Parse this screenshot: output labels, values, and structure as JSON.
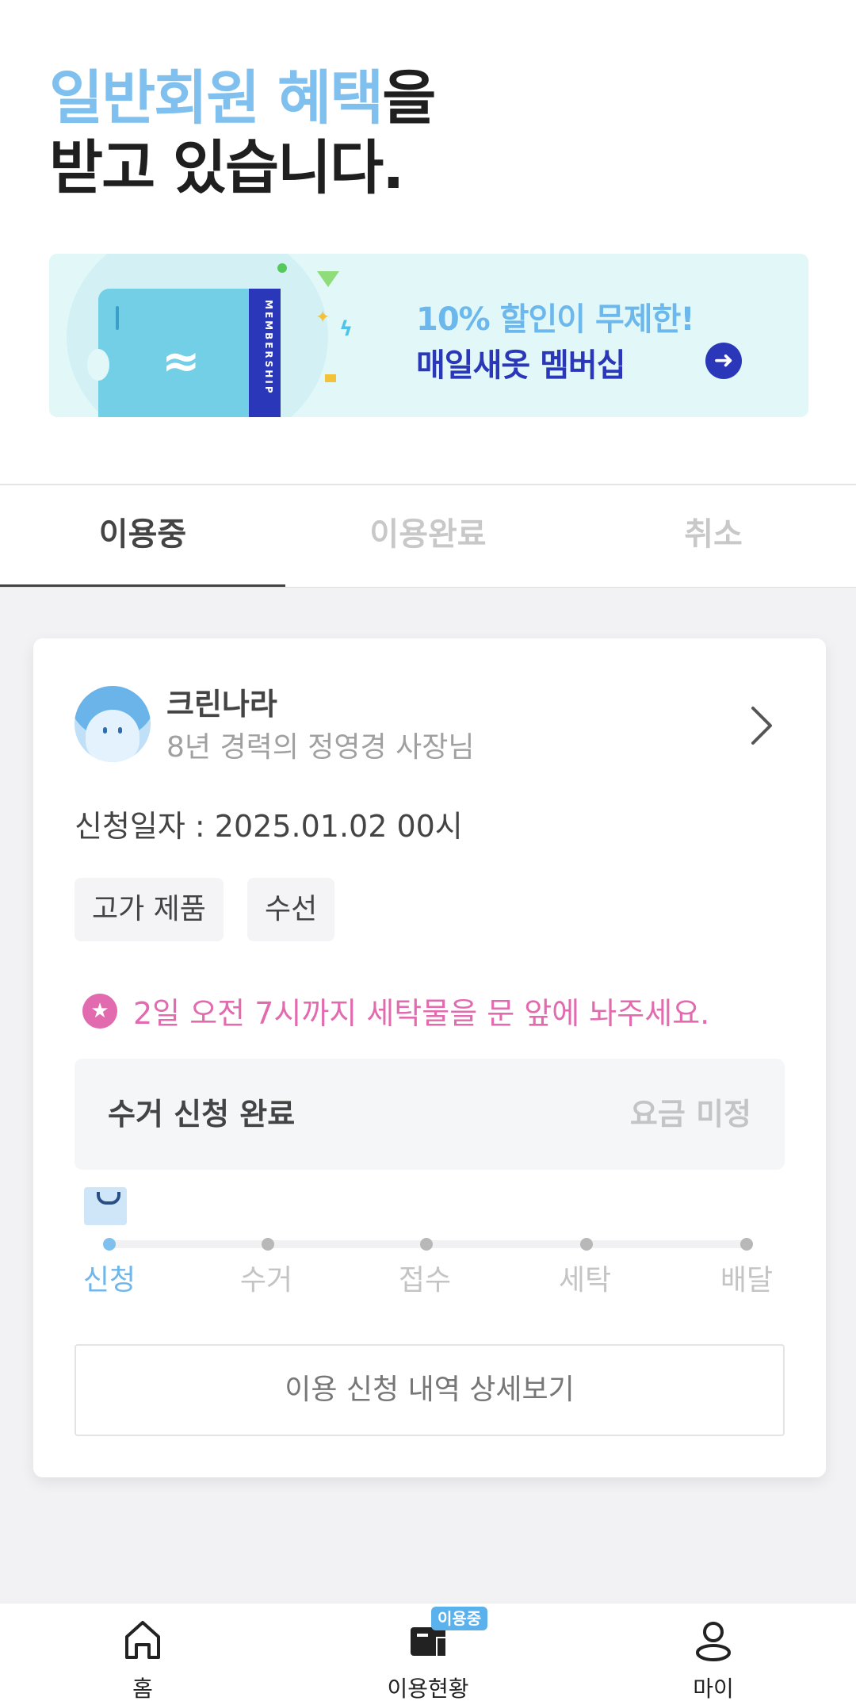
{
  "hero": {
    "accent": "일반회원 혜택",
    "rest1": "을",
    "line2": "받고 있습니다."
  },
  "banner": {
    "membership_text": "MEMBERSHIP",
    "title1": "10% 할인이 무제한!",
    "title2": "매일새옷 멤버십",
    "arrow_icon": "arrow-right-circle"
  },
  "tabs": [
    {
      "label": "이용중",
      "active": true
    },
    {
      "label": "이용완료",
      "active": false
    },
    {
      "label": "취소",
      "active": false
    }
  ],
  "card": {
    "store_name": "크린나라",
    "store_desc": "8년 경력의 정영경 사장님",
    "request_date": "신청일자 : 2025.01.02 00시",
    "tags": [
      "고가 제품",
      "수선"
    ],
    "notice": "2일 오전 7시까지 세탁물을 문 앞에 놔주세요.",
    "status_label": "수거 신청 완료",
    "price_label": "요금 미정",
    "steps": [
      "신청",
      "수거",
      "접수",
      "세탁",
      "배달"
    ],
    "current_step": 0,
    "detail_button": "이용 신청 내역 상세보기"
  },
  "nav": {
    "items": [
      {
        "label": "홈",
        "icon": "home-icon"
      },
      {
        "label": "이용현황",
        "icon": "usage-icon"
      },
      {
        "label": "마이",
        "icon": "user-icon"
      }
    ],
    "badge": "이용중"
  },
  "colors": {
    "accent": "#7fc0ef",
    "brand_navy": "#2a37b8",
    "notice_pink": "#e26aae"
  }
}
